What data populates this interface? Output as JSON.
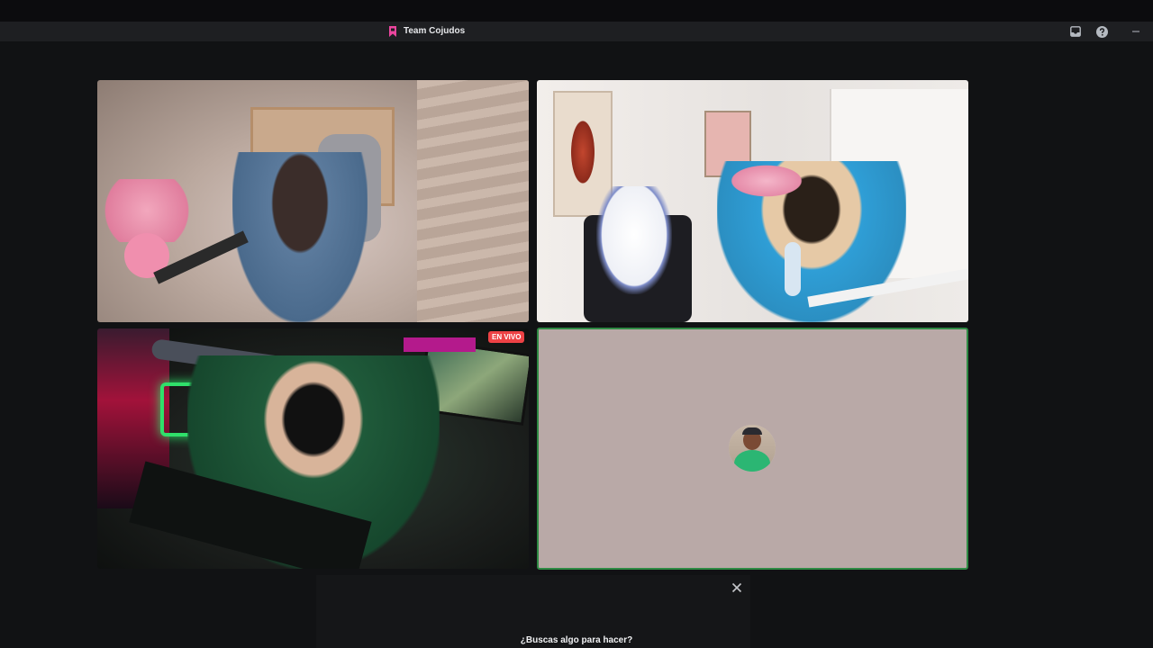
{
  "window": {
    "title": "Team Cojudos",
    "title_icon": "bookmark-icon",
    "accent_color": "#eb459e",
    "buttons": [
      {
        "name": "inbox-icon"
      },
      {
        "name": "help-icon"
      },
      {
        "name": "minimize-icon"
      }
    ]
  },
  "stage": {
    "tiles": [
      {
        "name": "participant-video-1",
        "type": "camera"
      },
      {
        "name": "participant-video-2",
        "type": "camera"
      },
      {
        "name": "participant-video-3",
        "type": "camera",
        "badge": "EN VIVO",
        "badge_color": "#ed4245"
      },
      {
        "name": "participant-avatar-4",
        "type": "avatar",
        "speaking_border": "#2f8a44",
        "background": "#b9a9a7"
      }
    ]
  },
  "activity_panel": {
    "prompt": "¿Buscas algo para hacer?",
    "close_icon": "close-icon"
  }
}
